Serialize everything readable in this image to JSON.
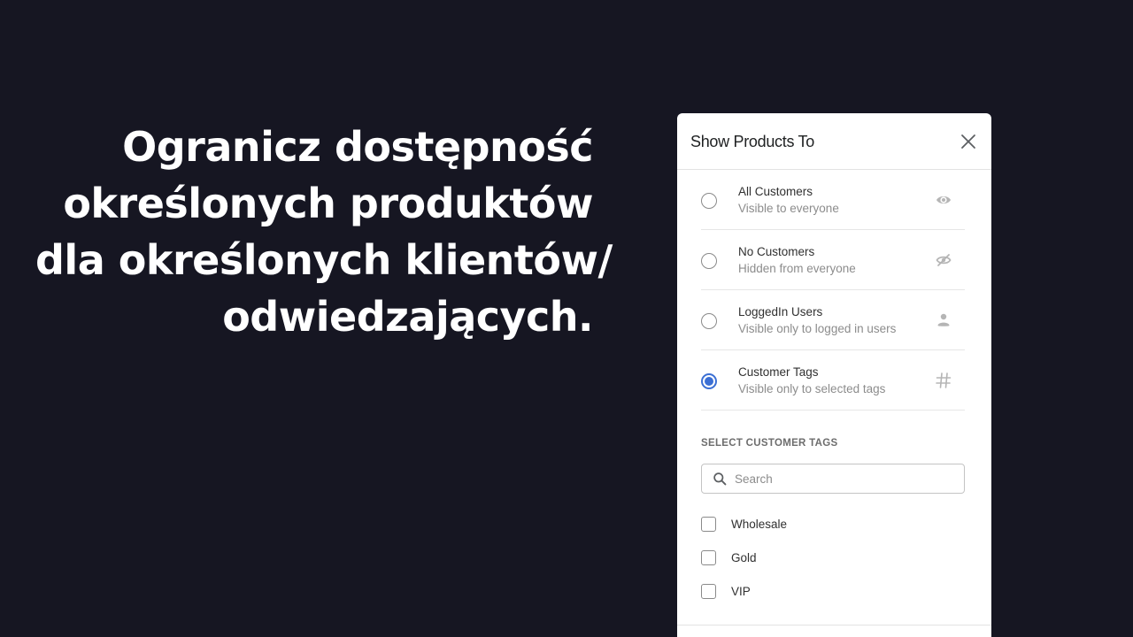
{
  "headline": {
    "lines": [
      "Ogranicz dostępność",
      "określonych produktów",
      "dla określonych klientów/",
      "odwiedzających."
    ]
  },
  "panel": {
    "title": "Show Products To",
    "close_icon": "close-icon",
    "options": [
      {
        "label": "All Customers",
        "sublabel": "Visible to everyone",
        "icon": "eye-icon",
        "selected": false
      },
      {
        "label": "No Customers",
        "sublabel": "Hidden from everyone",
        "icon": "eye-slash-icon",
        "selected": false
      },
      {
        "label": "LoggedIn Users",
        "sublabel": "Visible only to logged in users",
        "icon": "user-icon",
        "selected": false
      },
      {
        "label": "Customer Tags",
        "sublabel": "Visible only to selected tags",
        "icon": "hashtag-icon",
        "selected": true
      }
    ],
    "tags_section": {
      "heading": "SELECT CUSTOMER TAGS",
      "search": {
        "placeholder": "Search",
        "value": "",
        "icon": "search-icon"
      },
      "tags": [
        {
          "label": "Wholesale",
          "checked": false
        },
        {
          "label": "Gold",
          "checked": false
        },
        {
          "label": "VIP",
          "checked": false
        }
      ]
    }
  },
  "colors": {
    "background": "#161622",
    "accent": "#3b6fd4",
    "panel": "#ffffff",
    "muted_text": "#8c8c8c"
  }
}
